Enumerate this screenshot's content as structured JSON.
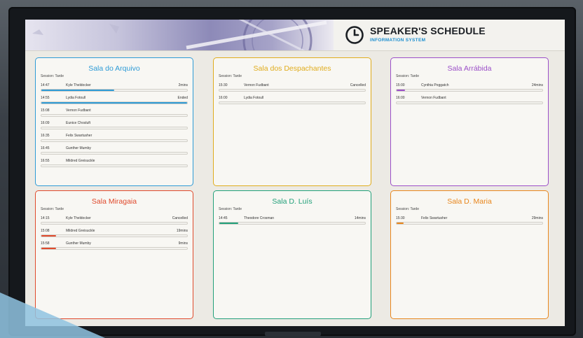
{
  "header": {
    "title": "SPEAKER'S SCHEDULE",
    "subtitle": "INFORMATION SYSTEM"
  },
  "rooms": [
    {
      "name": "Sala do Arquivo",
      "session": "Session: Tarde",
      "color": "#2e9bd6",
      "rows": [
        {
          "time": "14:47",
          "speaker": "Kyle Theldocker",
          "status": "2mins",
          "progress": 0.5
        },
        {
          "time": "14:55",
          "speaker": "Lydia Fotoull",
          "status": "Ended",
          "progress": 1.0
        },
        {
          "time": "15:08",
          "speaker": "Vernon Fudbant",
          "status": "",
          "progress": 0
        },
        {
          "time": "16:09",
          "speaker": "Eunice Chosluft",
          "status": "",
          "progress": 0
        },
        {
          "time": "16:35",
          "speaker": "Felix Swartusher",
          "status": "",
          "progress": 0
        },
        {
          "time": "16:45",
          "speaker": "Gunther Mumby",
          "status": "",
          "progress": 0
        },
        {
          "time": "16:55",
          "speaker": "Mildred Greisuckle",
          "status": "",
          "progress": 0
        }
      ]
    },
    {
      "name": "Sala dos Despachantes",
      "session": "Session: Tarde",
      "color": "#e0ac1c",
      "rows": [
        {
          "time": "15:30",
          "speaker": "Vernon Fudbant",
          "status": "Cancelled",
          "progress": 0
        },
        {
          "time": "16:00",
          "speaker": "Lydia Fotoull",
          "status": "",
          "progress": 0
        }
      ]
    },
    {
      "name": "Sala Arrábida",
      "session": "Session: Tarde",
      "color": "#9b4fc8",
      "rows": [
        {
          "time": "15:00",
          "speaker": "Cynthia Poggatch",
          "status": "24mins",
          "progress": 0.06
        },
        {
          "time": "16:00",
          "speaker": "Vernon Fudbant",
          "status": "",
          "progress": 0
        }
      ]
    },
    {
      "name": "Sala Miragaia",
      "session": "Session: Tarde",
      "color": "#e04a2c",
      "rows": [
        {
          "time": "14:15",
          "speaker": "Kyle Theldocker",
          "status": "Cancelled",
          "progress": 0
        },
        {
          "time": "15:08",
          "speaker": "Mildred Greisuckle",
          "status": "19mins",
          "progress": 0.1
        },
        {
          "time": "15:58",
          "speaker": "Gunther Mumby",
          "status": "9mins",
          "progress": 0.1
        }
      ]
    },
    {
      "name": "Sala D. Luís",
      "session": "Session: Tarde",
      "color": "#22a07a",
      "rows": [
        {
          "time": "14:45",
          "speaker": "Theodore Crosman",
          "status": "14mins",
          "progress": 0.13
        }
      ]
    },
    {
      "name": "Sala D. Maria",
      "session": "Session: Tarde",
      "color": "#e8861c",
      "rows": [
        {
          "time": "15:30",
          "speaker": "Felix Swartusher",
          "status": "29mins",
          "progress": 0.05
        }
      ]
    }
  ]
}
